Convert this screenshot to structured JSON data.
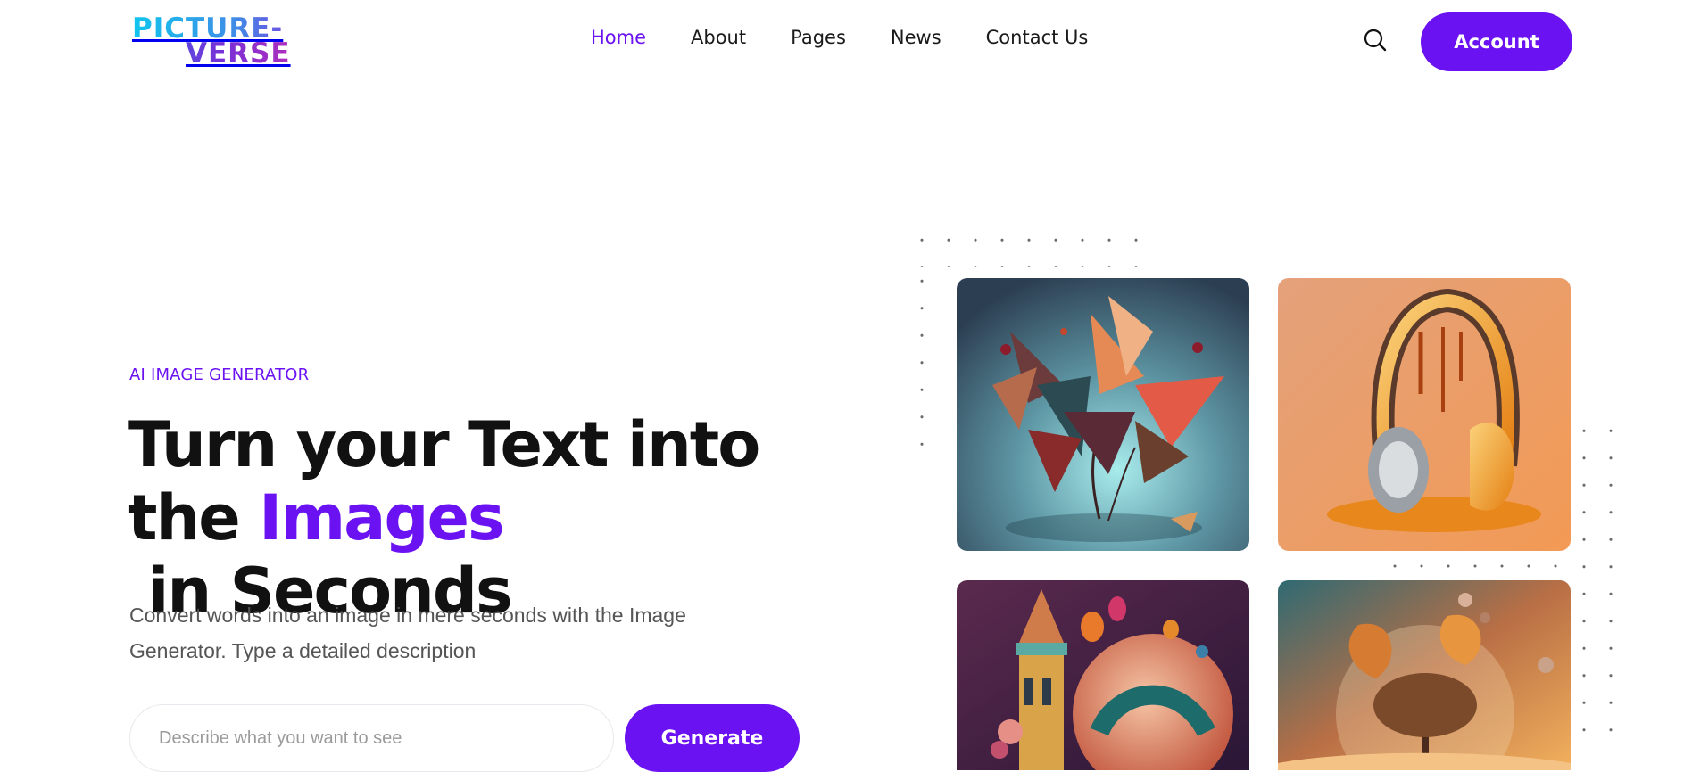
{
  "brand": {
    "logo_line1": "PICTURE-",
    "logo_line2": "VERSE"
  },
  "nav": {
    "items": [
      {
        "label": "Home",
        "active": true
      },
      {
        "label": "About",
        "active": false
      },
      {
        "label": "Pages",
        "active": false
      },
      {
        "label": "News",
        "active": false
      },
      {
        "label": "Contact Us",
        "active": false
      }
    ]
  },
  "header": {
    "search_icon": "search-icon",
    "account_label": "Account"
  },
  "hero": {
    "eyebrow": "AI IMAGE GENERATOR",
    "headline_part1": "Turn your Text into",
    "headline_part2": "the ",
    "headline_accent": "Images",
    "headline_part3": " in Seconds",
    "description": "Convert words into an image in mere seconds with the Image Generator. Type a detailed description",
    "input_placeholder": "Describe what you want to see",
    "input_value": "",
    "generate_label": "Generate"
  },
  "gallery": {
    "images": [
      {
        "subject": "autumn-leaves-bouquet"
      },
      {
        "subject": "melting-headphones"
      },
      {
        "subject": "fantasy-castle-balloons"
      },
      {
        "subject": "tree-in-glass-sphere"
      }
    ]
  },
  "colors": {
    "accent": "#6b12f2",
    "text": "#111111",
    "muted": "#555555"
  }
}
